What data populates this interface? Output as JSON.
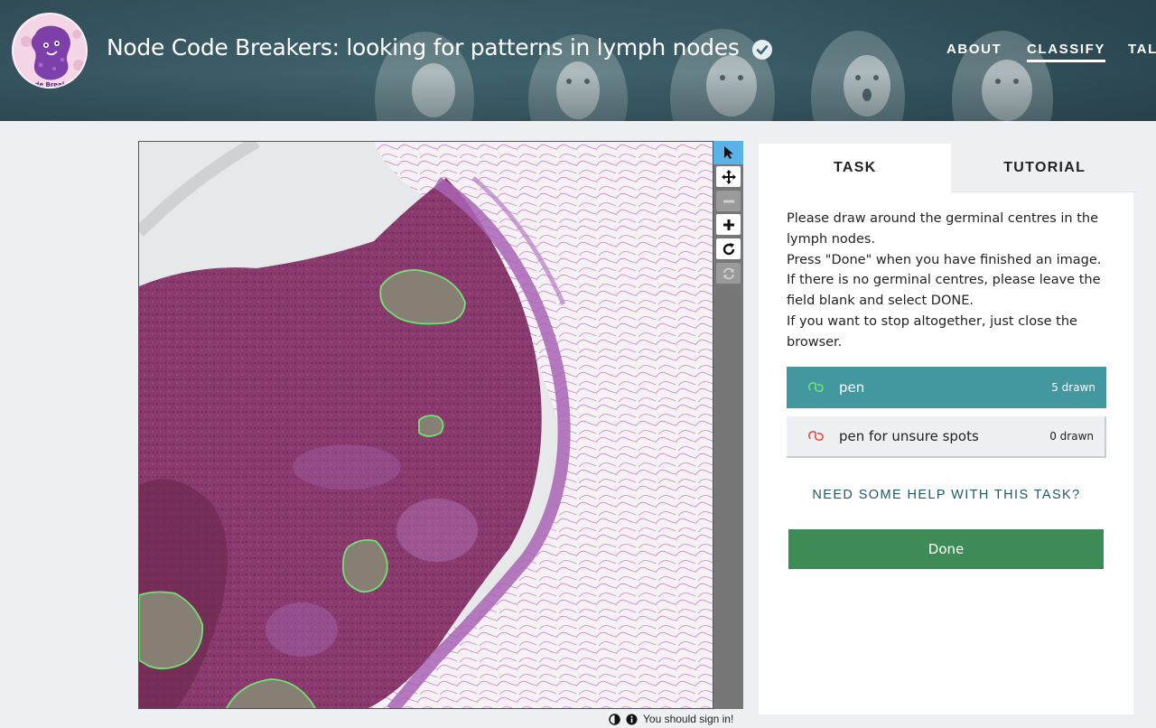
{
  "header": {
    "project_title": "Node Code Breakers: looking for patterns in lymph nodes",
    "logo_text": "Code Breakers",
    "nav": {
      "about": "ABOUT",
      "classify": "CLASSIFY",
      "talk": "TALK"
    }
  },
  "viewer": {
    "tools": [
      {
        "name": "pointer-icon",
        "state": "active"
      },
      {
        "name": "move-icon",
        "state": "enabled"
      },
      {
        "name": "zoom-out-icon",
        "state": "disabled"
      },
      {
        "name": "zoom-in-icon",
        "state": "enabled"
      },
      {
        "name": "rotate-icon",
        "state": "enabled"
      },
      {
        "name": "reset-icon",
        "state": "disabled"
      }
    ],
    "signin_text": "You should sign in!"
  },
  "panel": {
    "tabs": {
      "task": "TASK",
      "tutorial": "TUTORIAL"
    },
    "instructions": [
      "Please draw around the germinal centres in the lymph nodes.",
      "Press \"Done\" when you have finished an image.",
      "If there is no germinal centres, please leave the field blank and select DONE.",
      "If you want to stop altogether, just close the browser."
    ],
    "drawing_tools": [
      {
        "label": "pen",
        "count": "5 drawn",
        "color": "#6fe36f",
        "selected": true
      },
      {
        "label": "pen for unsure spots",
        "count": "0 drawn",
        "color": "#e84a3c",
        "selected": false
      }
    ],
    "help_text": "NEED SOME HELP WITH THIS TASK?",
    "done_label": "Done"
  },
  "colors": {
    "header_bg": "#3f6470",
    "selected_tool": "#43979f",
    "done_button": "#3d8c57",
    "help_link": "#1f5964",
    "active_tool": "#59b3e8",
    "annotation_outline": "#6fe36f"
  }
}
